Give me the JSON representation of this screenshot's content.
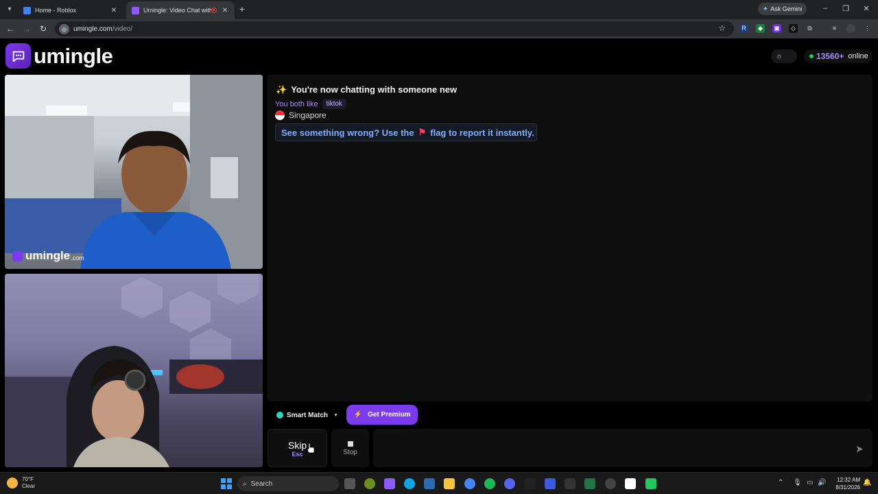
{
  "browser": {
    "tabs": [
      {
        "title": "Home - Roblox",
        "favicon_color": "#3b82f6"
      },
      {
        "title": "Umingle: Video Chat with S",
        "favicon_color": "#8b5cf6"
      }
    ],
    "ask_gemini": "Ask Gemini",
    "address": {
      "host": "umingle.com",
      "path": "/video/"
    }
  },
  "header": {
    "logo_text": "umingle",
    "online_count": "13560+",
    "online_label": "online"
  },
  "video": {
    "watermark": "umingle",
    "watermark_domain": ".com"
  },
  "chat": {
    "headline_icon": "✨",
    "headline": "You're now chatting with someone new",
    "likes_label": "You both like",
    "likes_tag": "tiktok",
    "country": "Singapore",
    "notice_before": "See something wrong? Use the",
    "notice_after": "flag to report it instantly."
  },
  "controls": {
    "smart_match": "Smart Match",
    "premium": "Get Premium",
    "skip": "Skip",
    "skip_key": "Esc",
    "stop": "Stop",
    "message_placeholder": ""
  },
  "taskbar": {
    "temp": "70°F",
    "condition": "Clear",
    "search": "Search",
    "time": "12:32 AM",
    "date": "8/31/2026"
  },
  "colors": {
    "accent": "#7c3aed",
    "online_dot": "#22c55e",
    "notice_text": "#7fb0ff"
  }
}
